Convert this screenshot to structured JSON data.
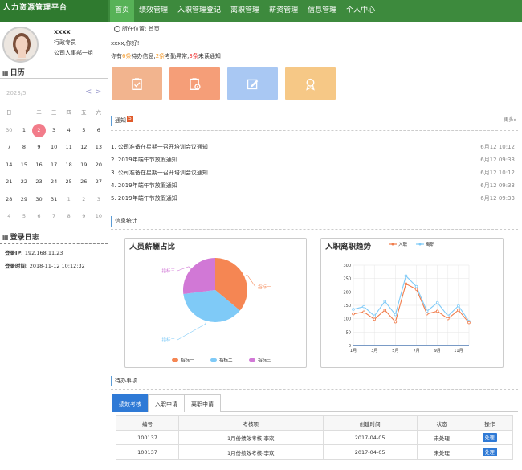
{
  "app": {
    "title": "人力资源管理平台"
  },
  "nav": {
    "items": [
      "首页",
      "绩效管理",
      "入职管理登记",
      "离职管理",
      "薪资管理",
      "信息管理",
      "个人中心"
    ]
  },
  "user": {
    "name": "xxxx",
    "role": "行政专员",
    "dept": "公司人事部一组"
  },
  "calendar": {
    "title": "日历",
    "month_label": "2023/5",
    "weekdays": [
      "日",
      "一",
      "二",
      "三",
      "四",
      "五",
      "六"
    ],
    "days": [
      "30",
      "1",
      "2",
      "3",
      "4",
      "5",
      "6",
      "7",
      "8",
      "9",
      "10",
      "11",
      "12",
      "13",
      "14",
      "15",
      "16",
      "17",
      "18",
      "19",
      "20",
      "21",
      "22",
      "23",
      "24",
      "25",
      "26",
      "27",
      "28",
      "29",
      "30",
      "31",
      "1",
      "2",
      "3",
      "4",
      "5",
      "6",
      "7",
      "8",
      "9",
      "10"
    ],
    "today": "2"
  },
  "login_log": {
    "title": "登录日志",
    "ip_label": "登录IP:",
    "ip": "192.168.11.23",
    "time_label": "登录时间:",
    "time": "2018-11-12 10:12:32"
  },
  "location": {
    "label": "所在位置:",
    "page": "首页"
  },
  "greeting": "xxxx,你好!",
  "summary": {
    "p1": "你有",
    "n1": "6条",
    "p2": "待办信息,",
    "n2": "2条",
    "p3": "考勤异常,",
    "n3": "3条",
    "p4": "未读通知"
  },
  "tiles": [
    {
      "icon": "clipboard-check-icon",
      "color": "#f2b48e"
    },
    {
      "icon": "clipboard-gear-icon",
      "color": "#f59e78"
    },
    {
      "icon": "edit-icon",
      "color": "#a9c8f3"
    },
    {
      "icon": "award-icon",
      "color": "#f6c886"
    }
  ],
  "notices": {
    "title": "通知",
    "badge": "5",
    "more": "更多»",
    "items": [
      {
        "text": "1. 公司准备在星期一召开培训会议通知",
        "time": "6月12 10:12"
      },
      {
        "text": "2. 2019年端午节放假通知",
        "time": "6月12 09:33"
      },
      {
        "text": "3. 公司准备在星期一召开培训会议通知",
        "time": "6月12 10:12"
      },
      {
        "text": "4. 2019年端午节放假通知",
        "time": "6月12 09:33"
      },
      {
        "text": "5. 2019年端午节放假通知",
        "time": "6月12 09:33"
      }
    ]
  },
  "stats": {
    "title": "信息统计"
  },
  "pie": {
    "title": "人员薪酬占比",
    "legend": [
      "指标一",
      "指标二",
      "指标三"
    ],
    "colors": [
      "#f58653",
      "#7fcaf7",
      "#d178d6"
    ],
    "values": [
      36,
      37,
      27
    ]
  },
  "line": {
    "title": "入职离职趋势",
    "legend": [
      "入职",
      "离职"
    ],
    "colors": [
      "#f07b4a",
      "#7fcaf7"
    ],
    "x_labels": [
      "1月",
      "3月",
      "5月",
      "7月",
      "9月",
      "11月"
    ],
    "y_ticks": [
      "0",
      "50",
      "100",
      "150",
      "200",
      "250",
      "300"
    ],
    "ylim": [
      0,
      300
    ],
    "series": [
      {
        "name": "入职",
        "values": [
          118,
          125,
          98,
          132,
          88,
          230,
          210,
          118,
          128,
          100,
          132,
          85
        ]
      },
      {
        "name": "离职",
        "values": [
          135,
          145,
          110,
          165,
          115,
          260,
          220,
          128,
          160,
          110,
          148,
          90
        ]
      }
    ]
  },
  "tasks": {
    "title": "待办事项",
    "tabs": [
      "绩效考核",
      "入职申请",
      "离职申请"
    ],
    "headers": [
      "编号",
      "考核项",
      "创建时间",
      "状态",
      "操作"
    ],
    "rows": [
      {
        "id": "100137",
        "item": "1月份绩效考核-李欢",
        "date": "2017-04-05",
        "status": "未处理",
        "op": "处理"
      },
      {
        "id": "100137",
        "item": "1月份绩效考核-李欢",
        "date": "2017-04-05",
        "status": "未处理",
        "op": "处理"
      }
    ]
  }
}
